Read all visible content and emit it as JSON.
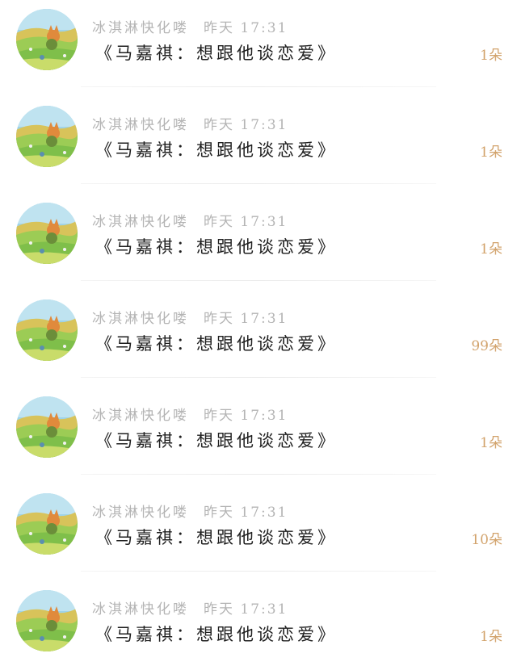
{
  "messages": [
    {
      "user": "冰淇淋快化喽",
      "time": "昨天 17:31",
      "title": "《马嘉祺：想跟他谈恋爱》",
      "count": "1朵"
    },
    {
      "user": "冰淇淋快化喽",
      "time": "昨天 17:31",
      "title": "《马嘉祺：想跟他谈恋爱》",
      "count": "1朵"
    },
    {
      "user": "冰淇淋快化喽",
      "time": "昨天 17:31",
      "title": "《马嘉祺：想跟他谈恋爱》",
      "count": "1朵"
    },
    {
      "user": "冰淇淋快化喽",
      "time": "昨天 17:31",
      "title": "《马嘉祺：想跟他谈恋爱》",
      "count": "99朵"
    },
    {
      "user": "冰淇淋快化喽",
      "time": "昨天 17:31",
      "title": "《马嘉祺：想跟他谈恋爱》",
      "count": "1朵"
    },
    {
      "user": "冰淇淋快化喽",
      "time": "昨天 17:31",
      "title": "《马嘉祺：想跟他谈恋爱》",
      "count": "10朵"
    },
    {
      "user": "冰淇淋快化喽",
      "time": "昨天 17:31",
      "title": "《马嘉祺：想跟他谈恋爱》",
      "count": "1朵"
    }
  ],
  "avatar_icon": "landscape-fox-avatar",
  "colors": {
    "count": "#d2a36c",
    "meta": "#b4b4b4",
    "title": "#1f1f1f"
  }
}
